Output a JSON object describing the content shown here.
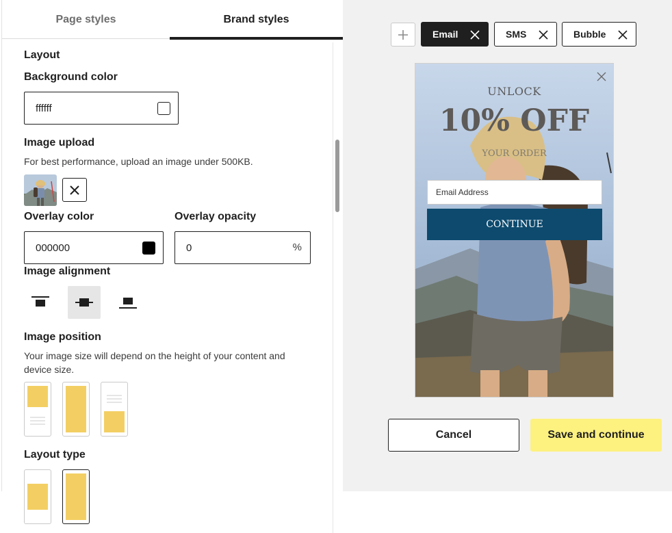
{
  "tabs": [
    {
      "label": "Page styles",
      "active": false
    },
    {
      "label": "Brand styles",
      "active": true
    }
  ],
  "panel": {
    "layout_heading": "Layout",
    "background_color": {
      "label": "Background color",
      "value": "ffffff",
      "swatch": "#ffffff"
    },
    "image_upload": {
      "label": "Image upload",
      "help": "For best performance, upload an image under 500KB."
    },
    "overlay_color": {
      "label": "Overlay color",
      "value": "000000",
      "swatch": "#000000"
    },
    "overlay_opacity": {
      "label": "Overlay opacity",
      "value": "0",
      "unit": "%"
    },
    "image_alignment": {
      "label": "Image alignment",
      "options": [
        "top",
        "center",
        "bottom"
      ],
      "selected": "center"
    },
    "image_position": {
      "label": "Image position",
      "help": "Your image size will depend on the height of your content and device size.",
      "options": [
        "top",
        "full",
        "bottom"
      ]
    },
    "layout_type": {
      "label": "Layout type",
      "options": [
        "inset",
        "full"
      ],
      "selected": "full"
    }
  },
  "channels": {
    "add_icon": "plus-icon",
    "chips": [
      {
        "label": "Email",
        "active": true
      },
      {
        "label": "SMS",
        "active": false
      },
      {
        "label": "Bubble",
        "active": false
      }
    ]
  },
  "preview": {
    "headline_small": "UNLOCK",
    "headline_big": "10% OFF",
    "headline_sub": "YOUR ORDER",
    "email_placeholder": "Email Address",
    "cta_label": "CONTINUE",
    "cta_color": "#0d4a6e"
  },
  "actions": {
    "cancel_label": "Cancel",
    "save_label": "Save and continue",
    "save_color": "#fdf180"
  },
  "colors": {
    "accent_yellow": "#f3cf63",
    "dark": "#1f1f1f",
    "preview_bg": "#f1f1f1"
  }
}
